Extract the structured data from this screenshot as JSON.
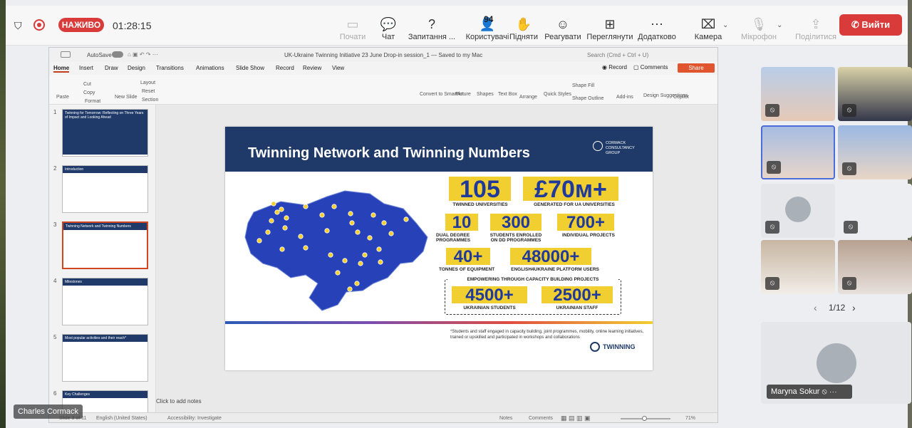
{
  "meeting": {
    "live_label": "НАЖИВО",
    "timer": "01:28:15",
    "controls": [
      {
        "label": "Почати",
        "icon": "screen-share-icon",
        "glyph": "▭",
        "enabled": false
      },
      {
        "label": "Чат",
        "icon": "chat-icon",
        "glyph": "💬",
        "enabled": true
      },
      {
        "label": "Запитання ...",
        "icon": "question-icon",
        "glyph": "?",
        "enabled": true
      },
      {
        "label": "Користувачі",
        "icon": "people-icon",
        "glyph": "👤",
        "enabled": true
      },
      {
        "label": "Підняти",
        "icon": "raise-hand-icon",
        "glyph": "✋",
        "enabled": true
      },
      {
        "label": "Реагувати",
        "icon": "smile-icon",
        "glyph": "☺",
        "enabled": true
      },
      {
        "label": "Переглянути",
        "icon": "layout-icon",
        "glyph": "⊞",
        "enabled": true
      },
      {
        "label": "Додатково",
        "icon": "more-icon",
        "glyph": "⋯",
        "enabled": true
      },
      {
        "label": "Камера",
        "icon": "camera-off-icon",
        "glyph": "⌧",
        "enabled": true
      },
      {
        "label": "Мікрофон",
        "icon": "mic-off-icon",
        "glyph": "🎙",
        "enabled": false
      },
      {
        "label": "Поділитися",
        "icon": "share-icon",
        "glyph": "⇪",
        "enabled": false
      }
    ],
    "participants_count": "94",
    "leave_label": "Вийти",
    "presenter_name": "Charles Cormack",
    "pagination": "1/12",
    "speaker_name": "Maryna Sokur"
  },
  "ppt": {
    "autosave": "AutoSave",
    "doc_title": "UK-Ukraine Twinning Initiative 23 June Drop-in session_1 — Saved to my Mac",
    "search": "Search (Cmd + Ctrl + U)",
    "tabs": [
      "Home",
      "Insert",
      "Draw",
      "Design",
      "Transitions",
      "Animations",
      "Slide Show",
      "Record",
      "Review",
      "View"
    ],
    "record": "Record",
    "comments": "Comments",
    "share": "Share",
    "ribbon_items": [
      "Paste",
      "Cut",
      "Copy",
      "Format",
      "New Slide",
      "Layout",
      "Reset",
      "Section",
      "Picture",
      "Shapes",
      "Text Box",
      "Arrange",
      "Quick Styles",
      "Shape Fill",
      "Shape Outline",
      "Add-ins",
      "Design Suggestions",
      "Copilot",
      "Convert to SmartArt"
    ],
    "thumbnails": [
      {
        "num": "1",
        "title": "Twinning for Tomorrow: Reflecting on Three Years of Impact and Looking Ahead"
      },
      {
        "num": "2",
        "title": "Introduction"
      },
      {
        "num": "3",
        "title": "Twinning Network and Twinning Numbers"
      },
      {
        "num": "4",
        "title": "Milestones"
      },
      {
        "num": "5",
        "title": "Most popular activities and their reach*"
      },
      {
        "num": "6",
        "title": "Key Challenges"
      }
    ],
    "notes": "Click to add notes",
    "status": {
      "slide": "Slide 3 of 11",
      "lang": "English (United States)",
      "access": "Accessibility: Investigate",
      "notes": "Notes",
      "comments": "Comments",
      "zoom": "71%"
    }
  },
  "slide": {
    "title": "Twinning Network and Twinning Numbers",
    "logo": "CORMACK CONSULTANCY GROUP",
    "stats": {
      "s1": {
        "value": "105",
        "label": "TWINNED UNIVERSITIES"
      },
      "s2": {
        "value": "£70м+",
        "label": "GENERATED FOR UA UNIVERSITIES"
      },
      "s3": {
        "value": "10",
        "label": "DUAL DEGREE PROGRAMMES"
      },
      "s4": {
        "value": "300",
        "label": "STUDENTS ENROLLED ON DD PROGRAMMES"
      },
      "s5": {
        "value": "700+",
        "label": "INDIVIDUAL PROJECTS"
      },
      "s6": {
        "value": "40+",
        "label": "TONNES OF EQUIPMENT"
      },
      "s7": {
        "value": "48000+",
        "label": "ENGLISH4UKRAINE PLATFORM USERS"
      },
      "s8": {
        "value": "4500+",
        "label": "UKRAINIAN STUDENTS"
      },
      "s9": {
        "value": "2500+",
        "label": "UKRAINIAN STAFF"
      }
    },
    "box_title": "EMPOWERING THROUGH CAPACITY BUILDING PROJECTS",
    "footnote": "*Students and staff engaged in capacity building, joint programmes, mobility, online learning initiatives, trained or upskilled and participated in workshops and collaborations",
    "brand": "TWINNING"
  },
  "colors": {
    "accent_blue": "#1f3a68",
    "highlight_yellow": "#f2cf30",
    "live_red": "#d93a3a",
    "leave_red": "#d93b3b",
    "share_orange": "#e0552e"
  }
}
